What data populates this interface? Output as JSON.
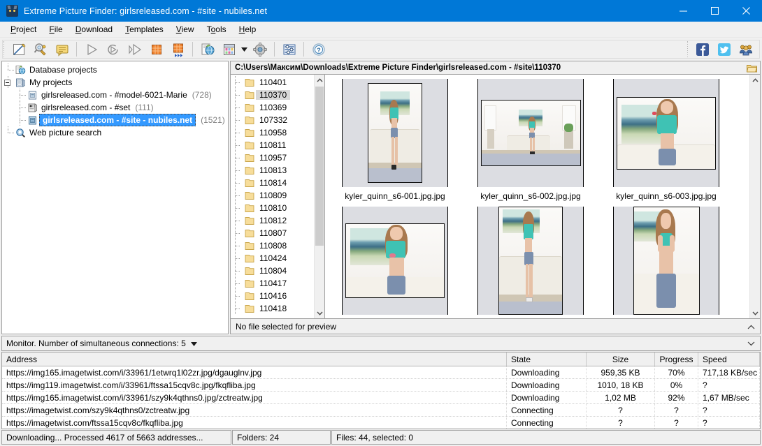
{
  "window": {
    "title": "Extreme Picture Finder: girlsreleased.com - #site - nubiles.net",
    "app_icon": "cat-head-icon",
    "minimize_label": "Minimize",
    "maximize_label": "Maximize",
    "close_label": "Close"
  },
  "menu": [
    {
      "label": "Project",
      "accel": "P"
    },
    {
      "label": "File",
      "accel": "F"
    },
    {
      "label": "Download",
      "accel": "D"
    },
    {
      "label": "Templates",
      "accel": "T"
    },
    {
      "label": "View",
      "accel": "V"
    },
    {
      "label": "Tools",
      "accel": "o"
    },
    {
      "label": "Help",
      "accel": "H"
    }
  ],
  "toolbar": {
    "buttons": [
      {
        "name": "new-project-icon",
        "title": "New project"
      },
      {
        "name": "project-wizard-icon",
        "title": "Project wizard"
      },
      {
        "name": "comment-icon",
        "title": "Comment"
      },
      {
        "name": "start-download-icon",
        "title": "Start download"
      },
      {
        "name": "resume-download-icon",
        "title": "Resume download"
      },
      {
        "name": "step-download-icon",
        "title": "Download step"
      },
      {
        "name": "stop-icon",
        "title": "Stop"
      },
      {
        "name": "stop-all-icon",
        "title": "Stop all"
      },
      {
        "name": "browse-web-icon",
        "title": "Open web page"
      },
      {
        "name": "schedule-icon",
        "title": "Scheduler"
      },
      {
        "name": "options-gear-icon",
        "title": "Options"
      },
      {
        "name": "filters-icon",
        "title": "Filters"
      },
      {
        "name": "help-icon",
        "title": "Help"
      }
    ],
    "social": [
      {
        "name": "facebook-icon",
        "title": "Facebook"
      },
      {
        "name": "twitter-icon",
        "title": "Twitter"
      },
      {
        "name": "community-icon",
        "title": "Community"
      }
    ]
  },
  "tree": {
    "nodes": [
      {
        "label": "Database projects",
        "icon": "database-projects-icon",
        "count": "",
        "indent": 1,
        "selected": false,
        "expander": false
      },
      {
        "label": "My projects",
        "icon": "my-projects-icon",
        "count": "",
        "indent": 0,
        "selected": false,
        "expander": true
      },
      {
        "label": "girlsreleased.com - #model-6021-Marie",
        "icon": "project-icon",
        "count": "(728)",
        "indent": 2,
        "selected": false,
        "expander": false
      },
      {
        "label": "girlsreleased.com - #set",
        "icon": "project-list-icon",
        "count": "(111)",
        "indent": 2,
        "selected": false,
        "expander": false
      },
      {
        "label": "girlsreleased.com - #site - nubiles.net",
        "icon": "project-icon",
        "count": "(1521)",
        "indent": 2,
        "selected": true,
        "expander": false
      },
      {
        "label": "Web picture search",
        "icon": "web-search-icon",
        "count": "",
        "indent": 1,
        "selected": false,
        "expander": false
      }
    ]
  },
  "address": {
    "path": "C:\\Users\\Максим\\Downloads\\Extreme Picture Finder\\girlsreleased.com - #site\\110370",
    "browse_icon": "open-folder-icon"
  },
  "folders": {
    "items": [
      {
        "name": "110401",
        "selected": false
      },
      {
        "name": "110370",
        "selected": true
      },
      {
        "name": "110369",
        "selected": false
      },
      {
        "name": "107332",
        "selected": false
      },
      {
        "name": "110958",
        "selected": false
      },
      {
        "name": "110811",
        "selected": false
      },
      {
        "name": "110957",
        "selected": false
      },
      {
        "name": "110813",
        "selected": false
      },
      {
        "name": "110814",
        "selected": false
      },
      {
        "name": "110809",
        "selected": false
      },
      {
        "name": "110810",
        "selected": false
      },
      {
        "name": "110812",
        "selected": false
      },
      {
        "name": "110807",
        "selected": false
      },
      {
        "name": "110808",
        "selected": false
      },
      {
        "name": "110424",
        "selected": false
      },
      {
        "name": "110804",
        "selected": false
      },
      {
        "name": "110417",
        "selected": false
      },
      {
        "name": "110416",
        "selected": false
      },
      {
        "name": "110418",
        "selected": false
      }
    ]
  },
  "thumbnails": [
    {
      "name": "kyler_quinn_s6-001.jpg.jpg",
      "pose": "standing-full"
    },
    {
      "name": "kyler_quinn_s6-002.jpg.jpg",
      "pose": "room-wide"
    },
    {
      "name": "kyler_quinn_s6-003.jpg.jpg",
      "pose": "torso"
    },
    {
      "name": "",
      "pose": "torso"
    },
    {
      "name": "",
      "pose": "standing-full"
    },
    {
      "name": "",
      "pose": "torso"
    }
  ],
  "preview": {
    "text": "No file selected for preview",
    "collapse_icon": "chevron-up-icon"
  },
  "monitor": {
    "label": "Monitor. Number of simultaneous connections: 5",
    "dropdown_icon": "caret-down-icon",
    "collapse_icon": "chevron-down-icon"
  },
  "downloads": {
    "columns": [
      "Address",
      "State",
      "Size",
      "Progress",
      "Speed"
    ],
    "rows": [
      {
        "address": "https://img165.imagetwist.com/i/33961/1etwrq1l02zr.jpg/dgauglnv.jpg",
        "state": "Downloading",
        "size": "959,35 KB",
        "progress": "70%",
        "speed": "717,18 KB/sec"
      },
      {
        "address": "https://img119.imagetwist.com/i/33961/ftssa15cqv8c.jpg/fkqfliba.jpg",
        "state": "Downloading",
        "size": "1010, 18 KB",
        "progress": "0%",
        "speed": "?"
      },
      {
        "address": "https://img165.imagetwist.com/i/33961/szy9k4qthns0.jpg/zctreatw.jpg",
        "state": "Downloading",
        "size": "1,02 MB",
        "progress": "92%",
        "speed": "1,67 MB/sec"
      },
      {
        "address": "https://imagetwist.com/szy9k4qthns0/zctreatw.jpg",
        "state": "Connecting",
        "size": "?",
        "progress": "?",
        "speed": "?"
      },
      {
        "address": "https://imagetwist.com/ftssa15cqv8c/fkqfliba.jpg",
        "state": "Connecting",
        "size": "?",
        "progress": "?",
        "speed": "?"
      }
    ]
  },
  "statusbar": {
    "progress_text": "Downloading... Processed 4617 of 5663 addresses...",
    "folders_text": "Folders: 24",
    "files_text": "Files: 44, selected: 0"
  },
  "colors": {
    "titlebar": "#0078d7",
    "selection": "#3399ff",
    "folder": "#f5d98a",
    "chrome": "#f0f0f0"
  }
}
